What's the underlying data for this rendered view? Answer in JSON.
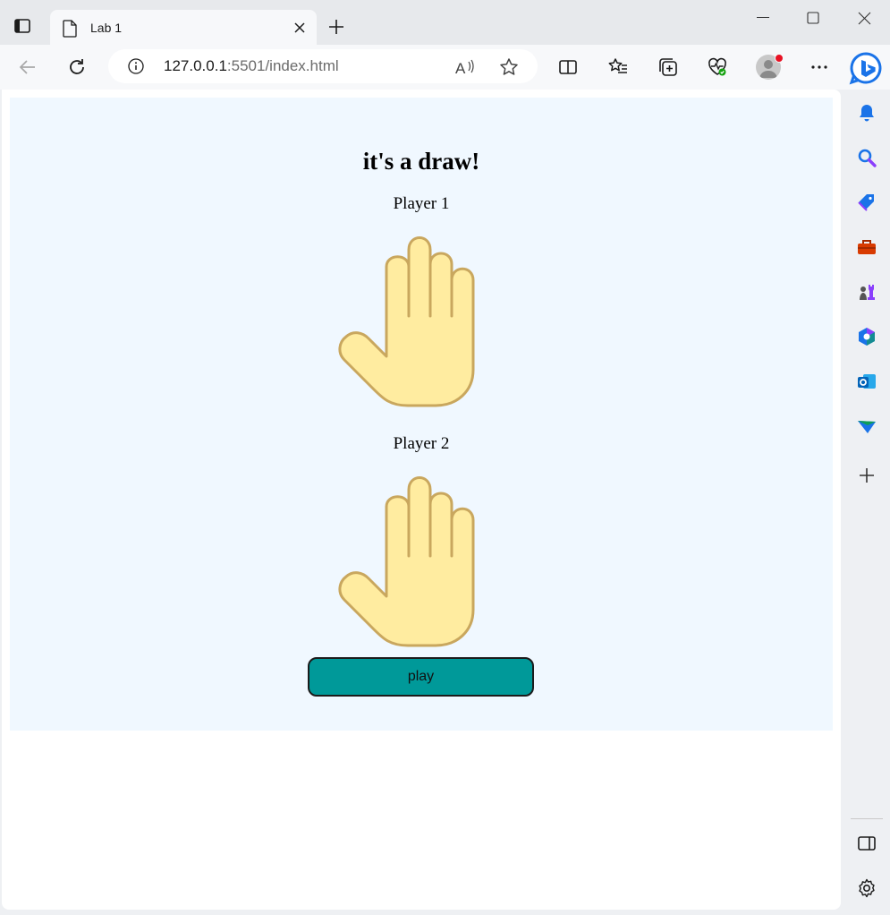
{
  "browser": {
    "tab": {
      "title": "Lab 1"
    },
    "address": {
      "host": "127.0.0.1",
      "rest": ":5501/index.html"
    },
    "colors": {
      "accent": "#0078d4",
      "profile_dot": "#e81123"
    }
  },
  "page": {
    "heading": "it's a draw!",
    "players": [
      {
        "label": "Player 1",
        "choice_icon": "raised-hand-icon"
      },
      {
        "label": "Player 2",
        "choice_icon": "raised-hand-icon"
      }
    ],
    "play_label": "play",
    "colors": {
      "background": "#f0f8ff",
      "button": "#009999",
      "hand_fill": "#ffeca0",
      "hand_stroke": "#c9a75e"
    }
  },
  "sidebar": {
    "items": [
      "bell-icon",
      "search-icon",
      "shopping-tag-icon",
      "toolbox-icon",
      "chess-games-icon",
      "office-icon",
      "outlook-icon",
      "send-drop-icon",
      "add-icon"
    ],
    "bottom": [
      "sidebar-toggle-icon",
      "settings-gear-icon"
    ]
  }
}
